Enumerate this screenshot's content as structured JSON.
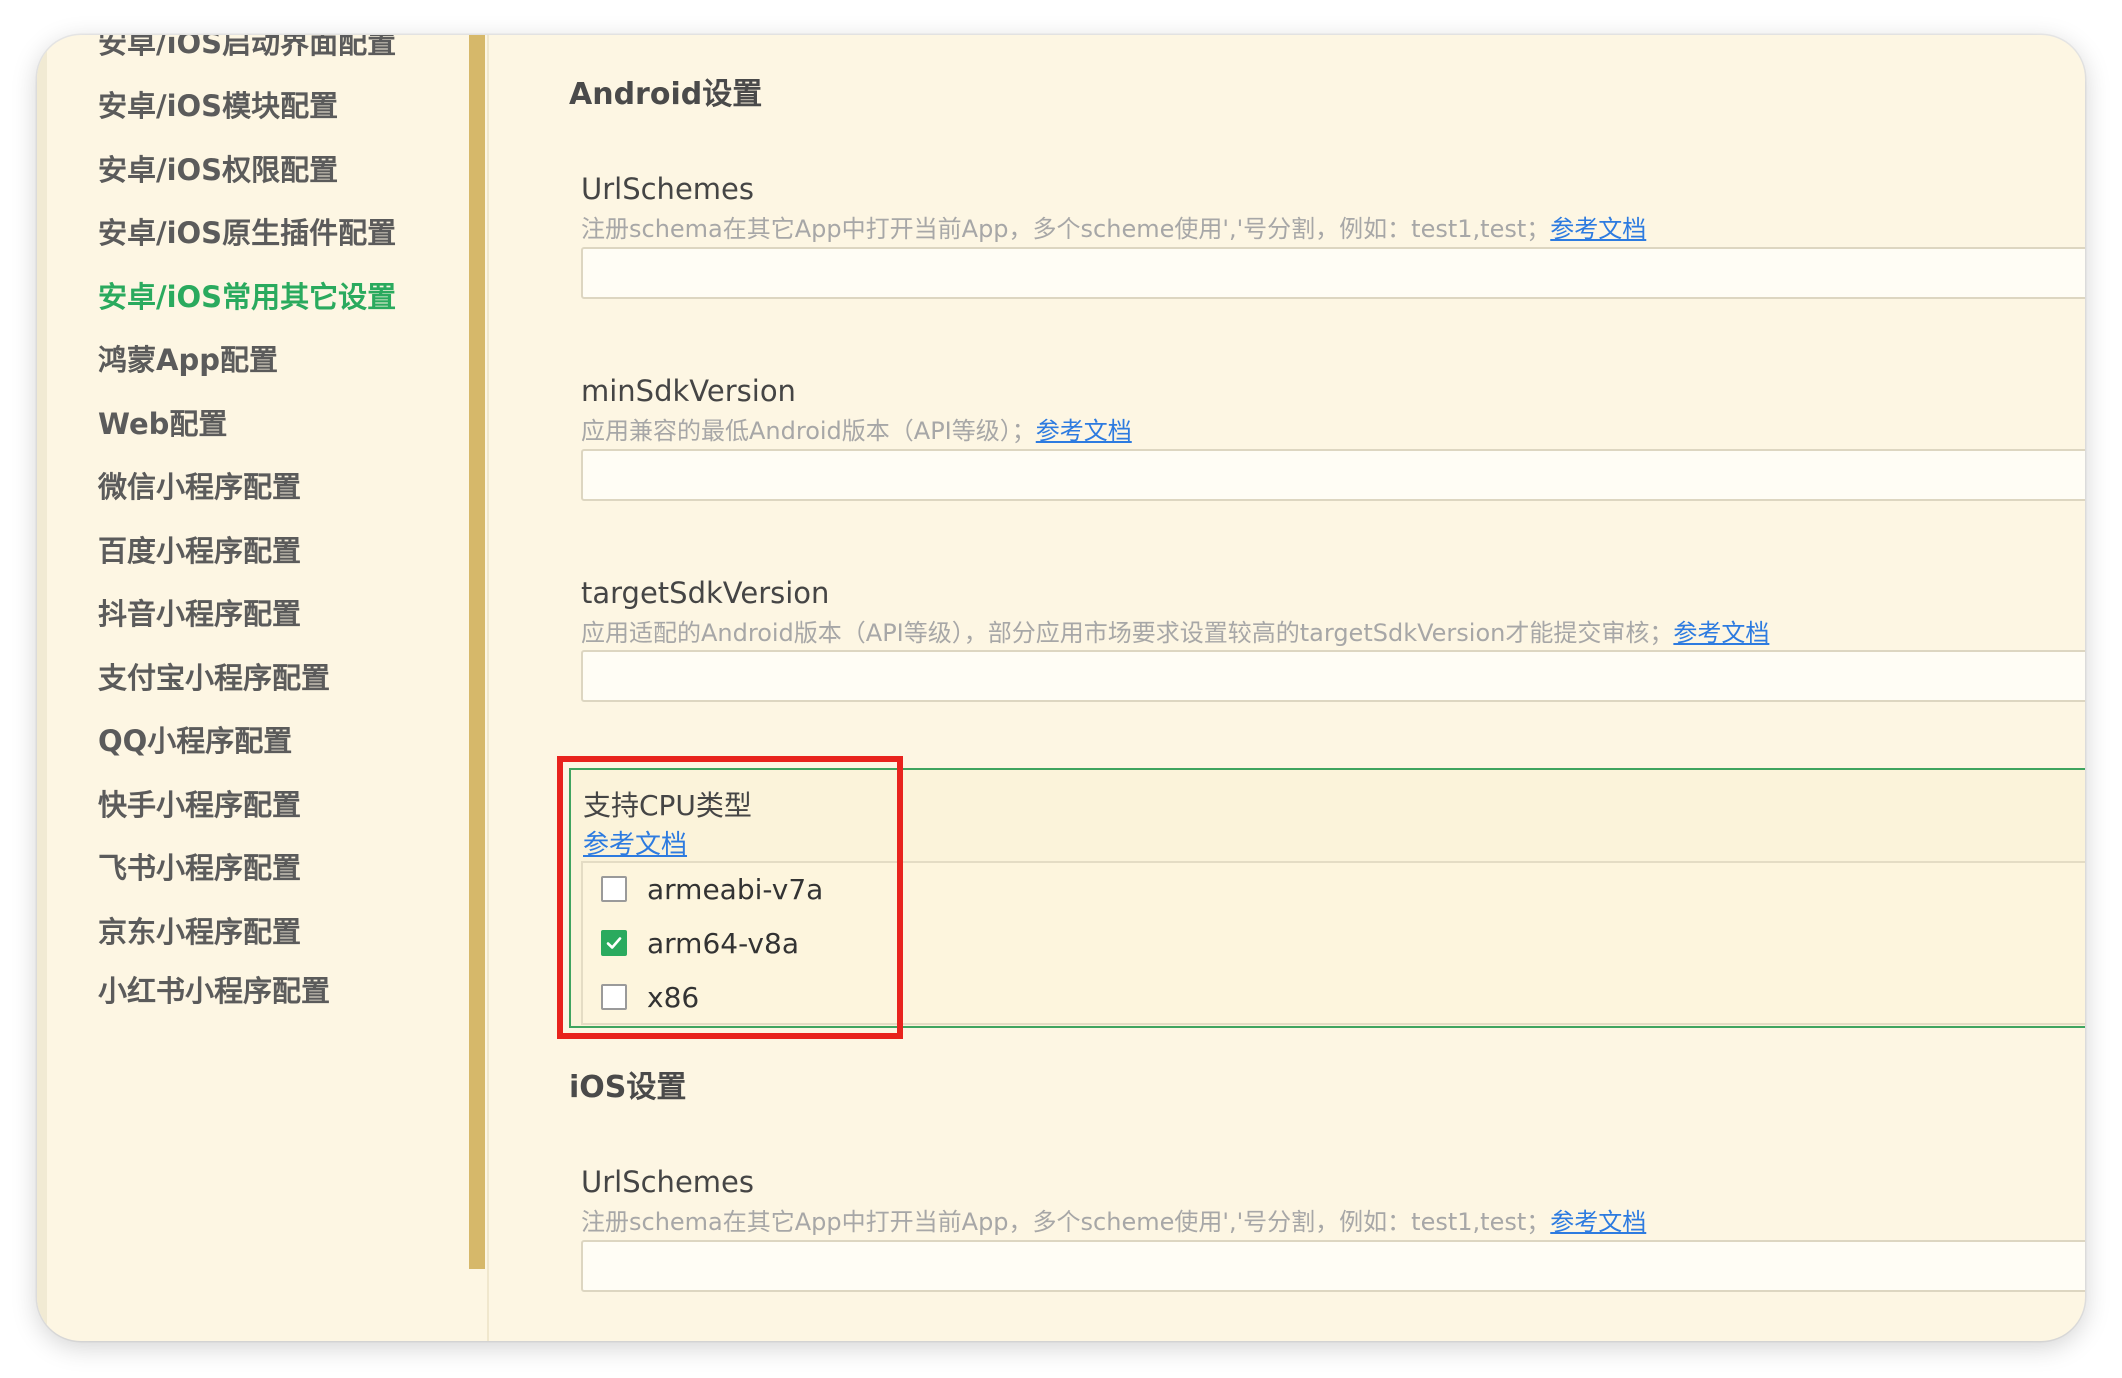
{
  "sidebar": {
    "items": [
      {
        "label": "安卓/iOS启动界面配置",
        "active": false
      },
      {
        "label": "安卓/iOS模块配置",
        "active": false
      },
      {
        "label": "安卓/iOS权限配置",
        "active": false
      },
      {
        "label": "安卓/iOS原生插件配置",
        "active": false
      },
      {
        "label": "安卓/iOS常用其它设置",
        "active": true
      },
      {
        "label": "鸿蒙App配置",
        "active": false
      },
      {
        "label": "Web配置",
        "active": false
      },
      {
        "label": "微信小程序配置",
        "active": false
      },
      {
        "label": "百度小程序配置",
        "active": false
      },
      {
        "label": "抖音小程序配置",
        "active": false
      },
      {
        "label": "支付宝小程序配置",
        "active": false
      },
      {
        "label": "QQ小程序配置",
        "active": false
      },
      {
        "label": "快手小程序配置",
        "active": false
      },
      {
        "label": "飞书小程序配置",
        "active": false
      },
      {
        "label": "京东小程序配置",
        "active": false
      },
      {
        "label": "小红书小程序配置",
        "active": false
      }
    ]
  },
  "android": {
    "title": "Android设置",
    "url_schemes": {
      "label": "UrlSchemes",
      "desc": "注册schema在其它App中打开当前App，多个scheme使用','号分割，例如：test1,test；",
      "link": "参考文档",
      "value": ""
    },
    "min_sdk": {
      "label": "minSdkVersion",
      "desc": "应用兼容的最低Android版本（API等级）；",
      "link": "参考文档",
      "value": ""
    },
    "target_sdk": {
      "label": "targetSdkVersion",
      "desc": "应用适配的Android版本（API等级），部分应用市场要求设置较高的targetSdkVersion才能提交审核；",
      "link": "参考文档",
      "value": ""
    },
    "cpu": {
      "label": "支持CPU类型",
      "link": "参考文档",
      "options": [
        {
          "label": "armeabi-v7a",
          "checked": false
        },
        {
          "label": "arm64-v8a",
          "checked": true
        },
        {
          "label": "x86",
          "checked": false
        }
      ]
    }
  },
  "ios": {
    "title": "iOS设置",
    "url_schemes": {
      "label": "UrlSchemes",
      "desc": "注册schema在其它App中打开当前App，多个scheme使用','号分割，例如：test1,test；",
      "link": "参考文档",
      "value": ""
    }
  },
  "colors": {
    "background": "#fdf6e3",
    "active_item": "#2aaa5e",
    "link": "#2d7be0",
    "checkbox_checked": "#2aaa5e",
    "highlight": "#e8231d",
    "scroll_thumb": "#d6b86a"
  }
}
